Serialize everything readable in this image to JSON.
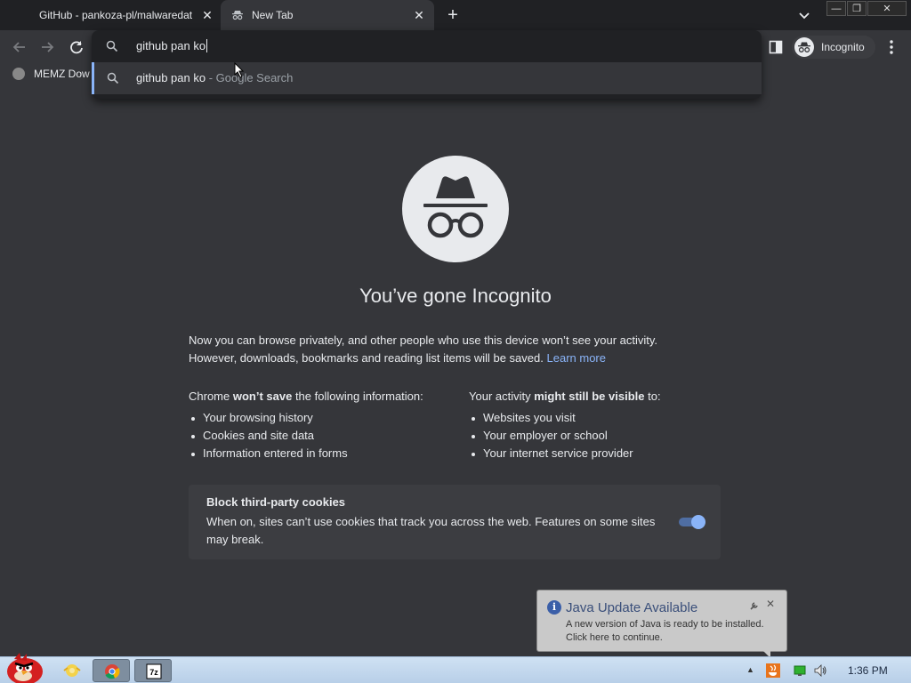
{
  "tabs": [
    {
      "title": "GitHub - pankoza-pl/malwaredat",
      "close": "✕"
    },
    {
      "title": "New Tab",
      "close": "✕"
    }
  ],
  "new_tab_symbol": "+",
  "window_controls": {
    "minimize": "—",
    "maximize": "❐",
    "close": "✕"
  },
  "toolbar": {
    "profile_label": "Incognito"
  },
  "bookmarks": [
    {
      "label": "MEMZ Dow"
    }
  ],
  "omnibox": {
    "typed_text": "github pan ko",
    "suggestion_query": "github pan ko",
    "suggestion_separator": " - ",
    "suggestion_source": "Google Search"
  },
  "incognito_page": {
    "heading": "You’ve gone Incognito",
    "intro_line1": "Now you can browse privately, and other people who use this device won’t see your activity.",
    "intro_line2": "However, downloads, bookmarks and reading list items will be saved.",
    "learn_more": "Learn more",
    "left_col": {
      "head_pre": "Chrome ",
      "head_bold": "won’t save",
      "head_post": " the following information:",
      "items": [
        "Your browsing history",
        "Cookies and site data",
        "Information entered in forms"
      ]
    },
    "right_col": {
      "head_pre": "Your activity ",
      "head_bold": "might still be visible",
      "head_post": " to:",
      "items": [
        "Websites you visit",
        "Your employer or school",
        "Your internet service provider"
      ]
    },
    "cookies": {
      "title": "Block third-party cookies",
      "description": "When on, sites can’t use cookies that track you across the web. Features on some sites may break.",
      "enabled": true
    }
  },
  "java_balloon": {
    "icon_glyph": "i",
    "title": "Java Update Available",
    "body": "A new version of Java is ready to be installed. Click here to continue.",
    "close": "✕"
  },
  "taskbar": {
    "app_7z_label": "7z",
    "tray_up": "▲",
    "clock": "1:36 PM"
  },
  "colors": {
    "accent": "#8ab4f8",
    "background": "#35363a",
    "tabstrip": "#202124"
  }
}
